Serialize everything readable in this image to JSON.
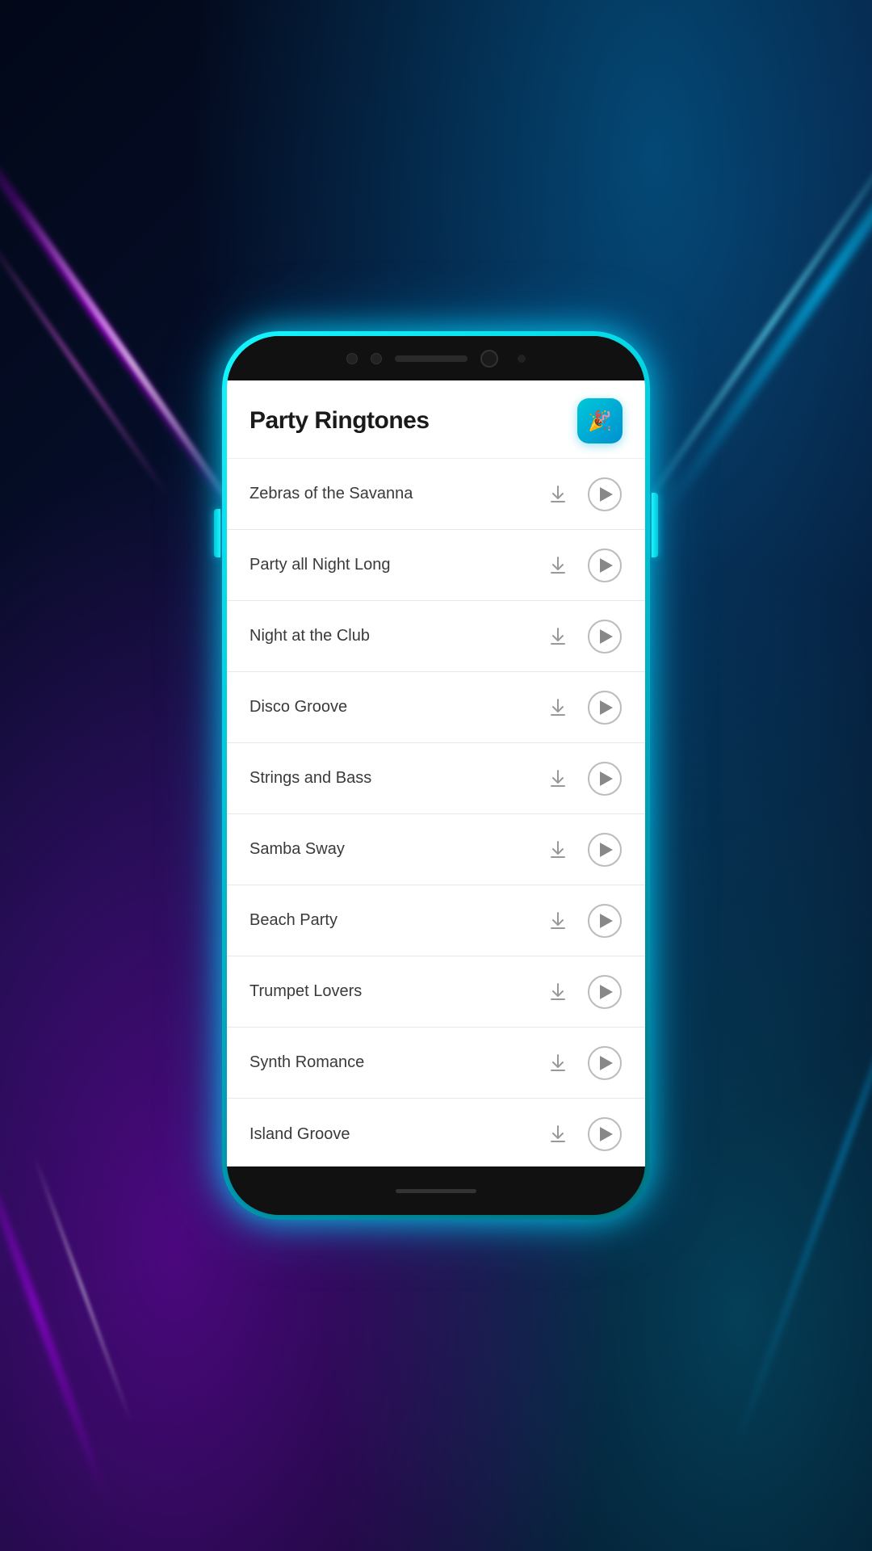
{
  "app": {
    "title": "Party Ringtones",
    "icon_emoji": "🎉"
  },
  "ringtones": [
    {
      "id": 1,
      "name": "Zebras of the Savanna"
    },
    {
      "id": 2,
      "name": "Party all Night Long"
    },
    {
      "id": 3,
      "name": "Night at the Club"
    },
    {
      "id": 4,
      "name": "Disco Groove"
    },
    {
      "id": 5,
      "name": "Strings and Bass"
    },
    {
      "id": 6,
      "name": "Samba Sway"
    },
    {
      "id": 7,
      "name": "Beach Party"
    },
    {
      "id": 8,
      "name": "Trumpet Lovers"
    },
    {
      "id": 9,
      "name": "Synth Romance"
    },
    {
      "id": 10,
      "name": "Island Groove"
    }
  ],
  "labels": {
    "download_label": "Download",
    "play_label": "Play"
  }
}
